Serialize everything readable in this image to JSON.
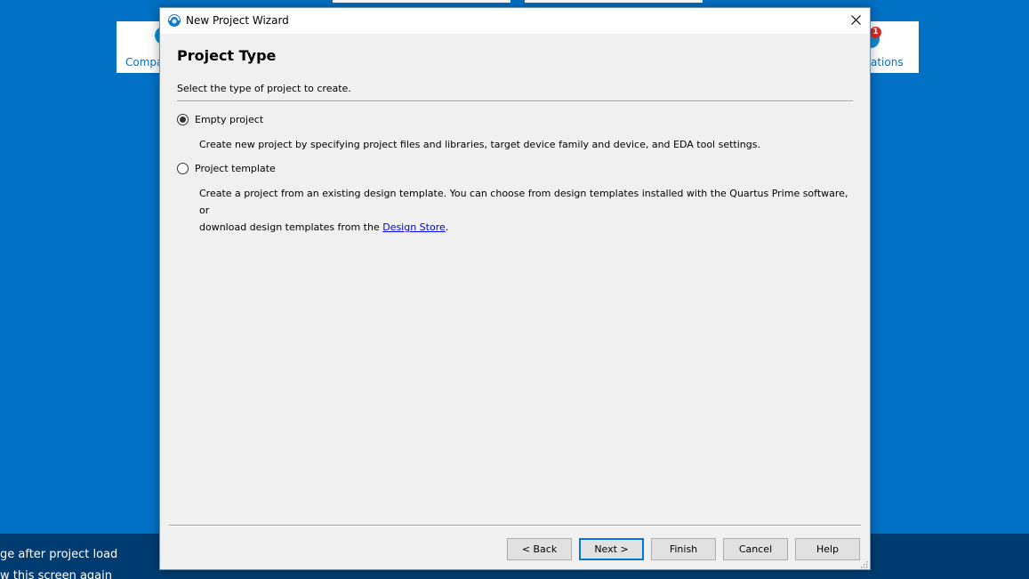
{
  "background": {
    "left_card_label": "Compa",
    "right_card_label": "ations",
    "notification_badge": "1",
    "footer_line1": "ge after project load",
    "footer_line2": "w this screen again"
  },
  "dialog": {
    "title": "New Project Wizard",
    "heading": "Project Type",
    "subheading": "Select the type of project to create.",
    "options": [
      {
        "label": "Empty project",
        "selected": true,
        "description": "Create new project by specifying project files and libraries, target device family and device, and EDA tool settings."
      },
      {
        "label": "Project template",
        "selected": false,
        "description_line1": "Create a project from an existing design template. You can choose from design templates installed with the Quartus Prime software, or",
        "description_line2_prefix": "download design templates from the ",
        "description_link": "Design Store",
        "description_line2_suffix": "."
      }
    ],
    "buttons": {
      "back": "< Back",
      "next": "Next >",
      "finish": "Finish",
      "cancel": "Cancel",
      "help": "Help"
    }
  },
  "colors": {
    "background": "#0071c5",
    "dialog_bg": "#f0f0f0",
    "accent": "#0078d7",
    "link": "#0000ee"
  }
}
